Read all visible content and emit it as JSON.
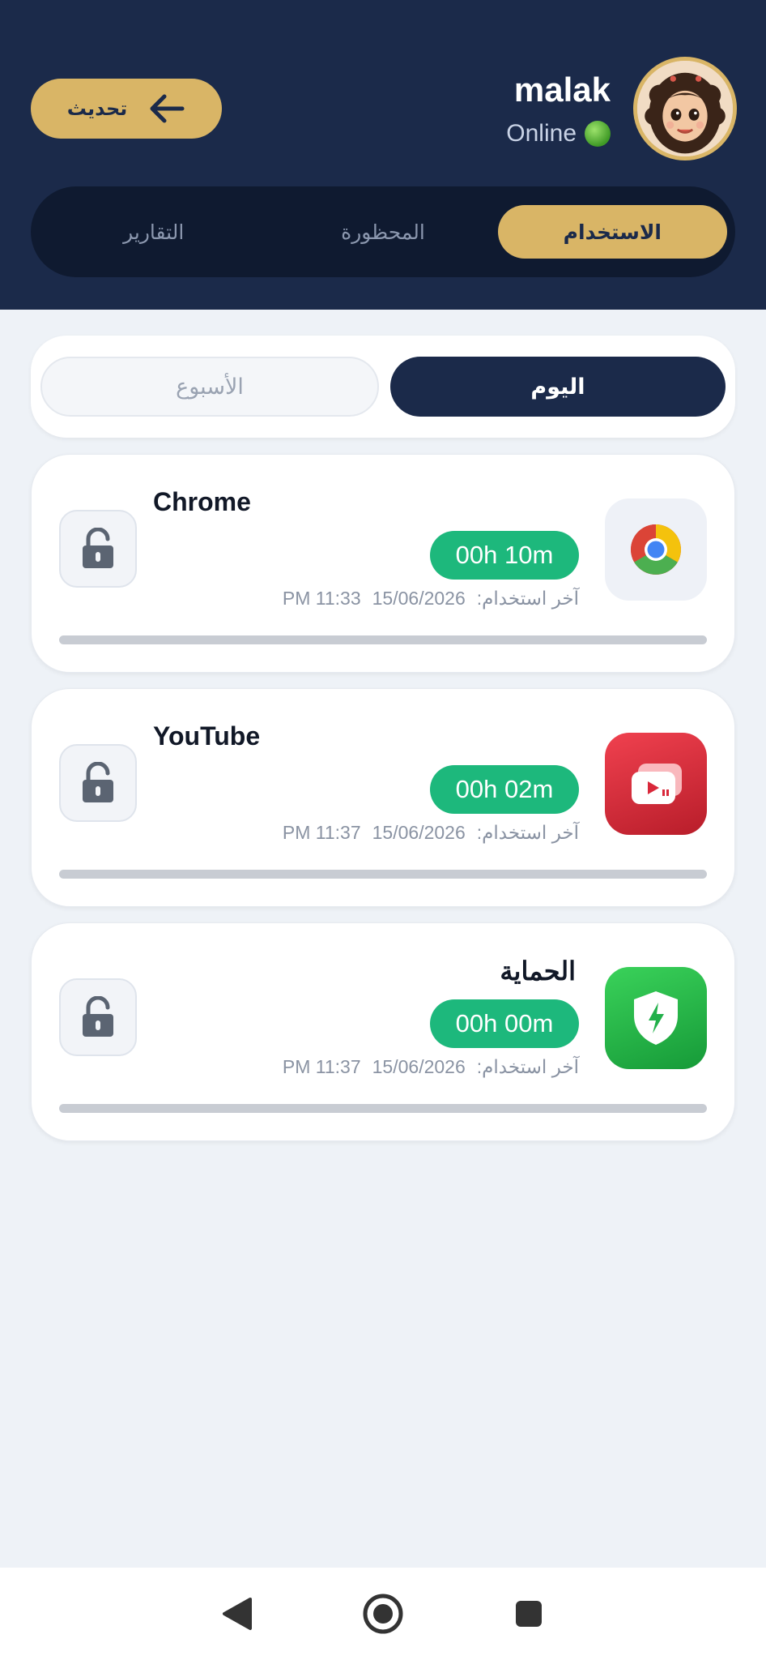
{
  "header": {
    "refresh_label": "تحديث",
    "user_name": "malak",
    "status_text": "Online",
    "tabs": [
      {
        "label": "الاستخدام",
        "active": true
      },
      {
        "label": "المحظورة",
        "active": false
      },
      {
        "label": "التقارير",
        "active": false
      }
    ]
  },
  "period": {
    "today": "اليوم",
    "week": "الأسبوع",
    "selected": "today"
  },
  "apps": [
    {
      "name": "Chrome",
      "icon": "chrome-icon",
      "usage": "00h 10m",
      "last_used_label": "آخر استخدام:",
      "last_used_date": "15/06/2026",
      "last_used_time": "PM 11:33"
    },
    {
      "name": "YouTube",
      "icon": "youtube-icon",
      "usage": "00h 02m",
      "last_used_label": "آخر استخدام:",
      "last_used_date": "15/06/2026",
      "last_used_time": "PM 11:37"
    },
    {
      "name": "الحماية",
      "icon": "shield-app-icon",
      "usage": "00h 00m",
      "last_used_label": "آخر استخدام:",
      "last_used_date": "15/06/2026",
      "last_used_time": "PM 11:37"
    }
  ],
  "colors": {
    "navy": "#1b2a4a",
    "gold": "#d9b566",
    "green_badge": "#1db87c",
    "background": "#eef2f7"
  }
}
